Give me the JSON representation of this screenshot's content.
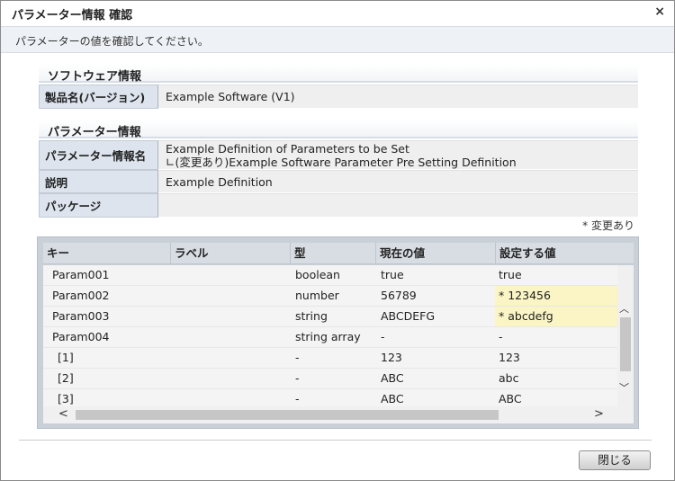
{
  "dialog": {
    "title": "パラメーター情報 確認",
    "close_symbol": "×",
    "instruction": "パラメーターの値を確認してください。"
  },
  "software_section": {
    "heading": "ソフトウェア情報",
    "product_label": "製品名(バージョン)",
    "product_value": "Example Software (V1)"
  },
  "parameter_section": {
    "heading": "パラメーター情報",
    "name_label": "パラメーター情報名",
    "name_value_line1": "Example Definition of Parameters to be Set",
    "name_value_line2": "∟(変更あり)Example Software Parameter Pre Setting Definition",
    "description_label": "説明",
    "description_value": "Example Definition",
    "package_label": "パッケージ",
    "package_value": ""
  },
  "changed_note": "* 変更あり",
  "grid": {
    "columns": [
      "キー",
      "ラベル",
      "型",
      "現在の値",
      "設定する値"
    ],
    "rows": [
      {
        "key": "Param001",
        "label": "",
        "type": "boolean",
        "current": "true",
        "new": "true",
        "changed": false
      },
      {
        "key": "Param002",
        "label": "",
        "type": "number",
        "current": "56789",
        "new": "* 123456",
        "changed": true
      },
      {
        "key": "Param003",
        "label": "",
        "type": "string",
        "current": "ABCDEFG",
        "new": "* abcdefg",
        "changed": true
      },
      {
        "key": "Param004",
        "label": "",
        "type": "string array",
        "current": "-",
        "new": "-",
        "changed": false
      },
      {
        "key": "[1]",
        "label": "",
        "type": "-",
        "current": "123",
        "new": "123",
        "changed": false
      },
      {
        "key": "[2]",
        "label": "",
        "type": "-",
        "current": "ABC",
        "new": "abc",
        "changed": false
      },
      {
        "key": "[3]",
        "label": "",
        "type": "-",
        "current": "ABC",
        "new": "ABC",
        "changed": false
      }
    ]
  },
  "scroll_symbols": {
    "up": "︿",
    "down": "﹀",
    "left": "<",
    "right": ">"
  },
  "footer": {
    "close_label": "閉じる"
  },
  "colors": {
    "changed_highlight": "#fbf5c5",
    "header_bg": "#dde4ee"
  }
}
